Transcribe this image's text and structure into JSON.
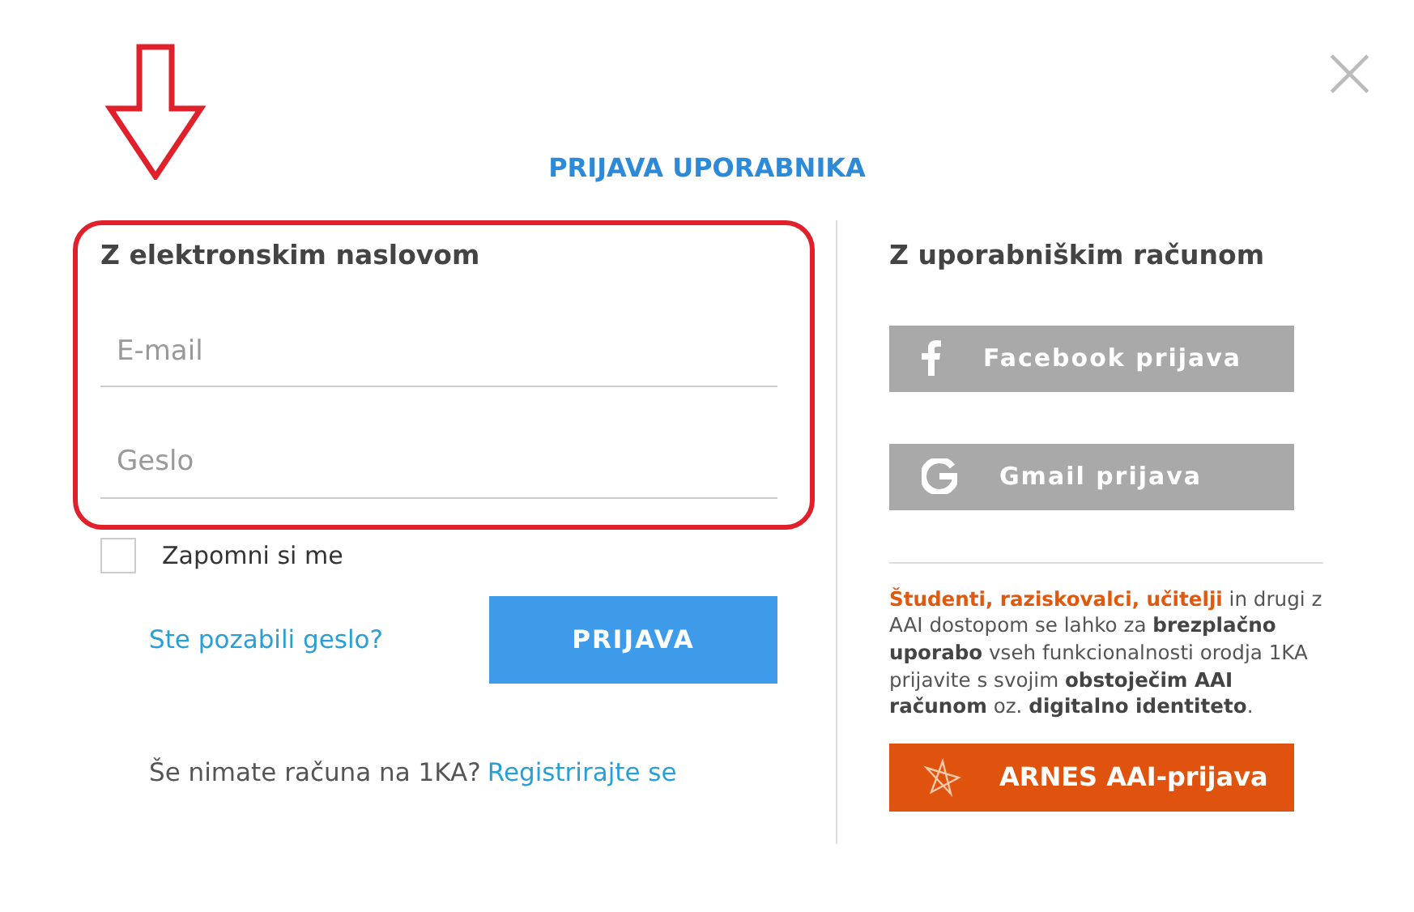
{
  "dialog": {
    "title": "PRIJAVA UPORABNIKA",
    "close": "×"
  },
  "email_login": {
    "heading": "Z elektronskim naslovom",
    "fields": [
      {
        "placeholder": "E-mail"
      },
      {
        "placeholder": "Geslo"
      }
    ],
    "remember": {
      "label": "Zapomni si me",
      "checked": false
    },
    "forgot_link": "Ste pozabili geslo?",
    "submit": "PRIJAVA",
    "register_prompt": "Še nimate računa na 1KA?",
    "register_link": "Registrirajte se"
  },
  "account_login": {
    "heading": "Z uporabniškim računom",
    "buttons": [
      {
        "kind": "facebook",
        "label": "Facebook prijava"
      },
      {
        "kind": "google",
        "label": "Gmail prijava"
      }
    ],
    "aai_text": "**Študenti, raziskovalci, učitelji** in drugi z AAI dostopom se lahko za **brezplačno uporabo** vseh funkcionalnosti orodja 1KA prijavite s svojim **obstoječim AAI računom** oz. **digitalno identiteto**.",
    "aai_button": "ARNES AAI-prijava"
  },
  "annotation": {
    "arrow": true,
    "highlight": true
  }
}
